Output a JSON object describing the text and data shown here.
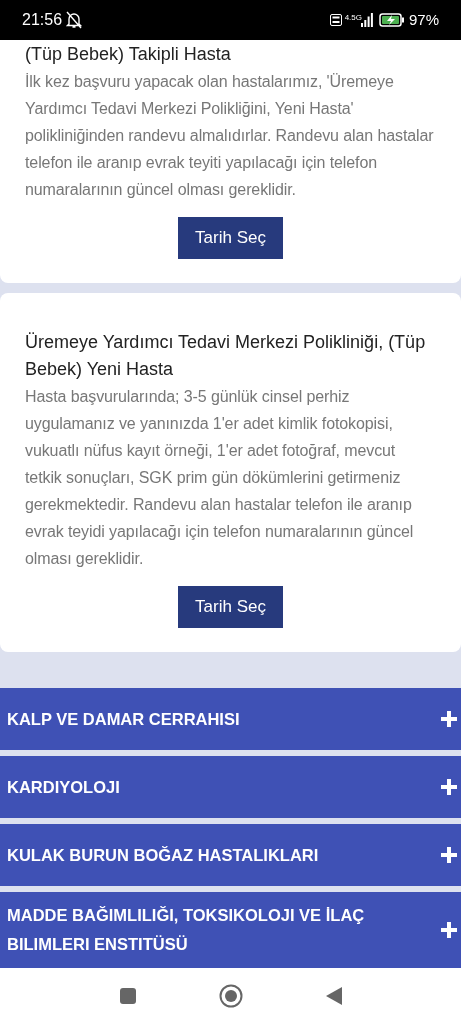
{
  "status_bar": {
    "time": "21:56",
    "network": "4.5G",
    "battery": "97%"
  },
  "cards": [
    {
      "title": "(Tüp Bebek) Takipli Hasta",
      "body": "İlk kez başvuru yapacak olan hastalarımız, 'Üremeye Yardımcı Tedavi Merkezi Polikliğini, Yeni Hasta' polikliniğinden randevu almalıdırlar. Randevu alan hastalar telefon ile aranıp evrak teyiti yapılacağı için telefon numaralarının güncel olması gereklidir.",
      "button": "Tarih Seç"
    },
    {
      "title": "Üremeye Yardımcı Tedavi Merkezi Polikliniği, (Tüp Bebek) Yeni Hasta",
      "body": "Hasta başvurularında; 3-5 günlük cinsel perhiz uygulamanız ve yanınızda 1'er adet kimlik fotokopisi, vukuatlı nüfus kayıt örneği, 1'er adet fotoğraf, mevcut tetkik sonuçları, SGK prim gün dökümlerini getirmeniz gerekmektedir. Randevu alan hastalar telefon ile aranıp evrak teyidi yapılacağı için telefon numaralarının güncel olması gereklidir.",
      "button": "Tarih Seç"
    }
  ],
  "departments": [
    {
      "label": "KALP VE DAMAR CERRAHISI",
      "expanded": false
    },
    {
      "label": "KARDIYOLOJI",
      "expanded": false
    },
    {
      "label": "KULAK BURUN BOĞAZ HASTALIKLARI",
      "expanded": false
    },
    {
      "label": "MADDE BAĞIMLILIĞI, TOKSIKOLOJI VE İLAÇ BILIMLERI ENSTITÜSÜ",
      "expanded": false
    }
  ]
}
